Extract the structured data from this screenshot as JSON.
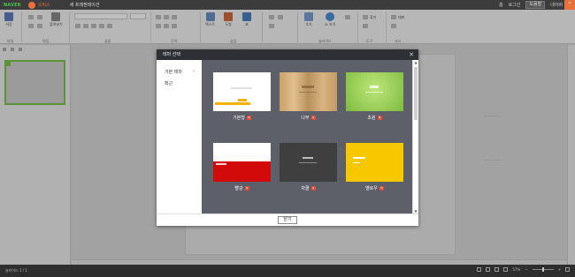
{
  "titlebar": {
    "logo": "NAVER",
    "app_name": "오피스",
    "doc_title": "새 프레젠테이션",
    "links": [
      "홈",
      "로그인"
    ],
    "user": "네이버",
    "help_btn": "도움말"
  },
  "ribbon": {
    "groups": [
      "파일",
      "편집",
      "글꼴",
      "단락",
      "삽입",
      "슬라이드",
      "도구",
      "서식"
    ],
    "tools": [
      {
        "name": "save",
        "label": "저장",
        "color": "#5b7fbf"
      },
      {
        "name": "paste",
        "label": "붙여넣기",
        "color": "#8a8a8a"
      },
      {
        "name": "textbox",
        "label": "텍스트",
        "color": "#6a8fc6"
      },
      {
        "name": "shape",
        "label": "도형",
        "color": "#d06a3a"
      },
      {
        "name": "table",
        "label": "표",
        "color": "#4a7fc0"
      },
      {
        "name": "add-slide",
        "label": "추가",
        "color": "#7a9fd0"
      },
      {
        "name": "slideshow",
        "label": "쇼 보기",
        "color": "#4a8fd6"
      },
      {
        "name": "find",
        "label": "찾기",
        "color": "#9aa7b8"
      },
      {
        "name": "theme",
        "label": "테마",
        "color": "#9aa7b8"
      }
    ]
  },
  "modal": {
    "title": "테마 선택",
    "sidebar": [
      "기본 테마",
      "최근"
    ],
    "close_btn": "닫기",
    "themes": [
      {
        "label": "기본형",
        "style": "basic"
      },
      {
        "label": "나무",
        "style": "wood"
      },
      {
        "label": "초원",
        "style": "green"
      },
      {
        "label": "빨강",
        "style": "red"
      },
      {
        "label": "차콜",
        "style": "dark"
      },
      {
        "label": "옐로우",
        "style": "yellow"
      }
    ]
  },
  "status": {
    "page": "슬라이드 1 / 1",
    "zoom": "57%"
  }
}
